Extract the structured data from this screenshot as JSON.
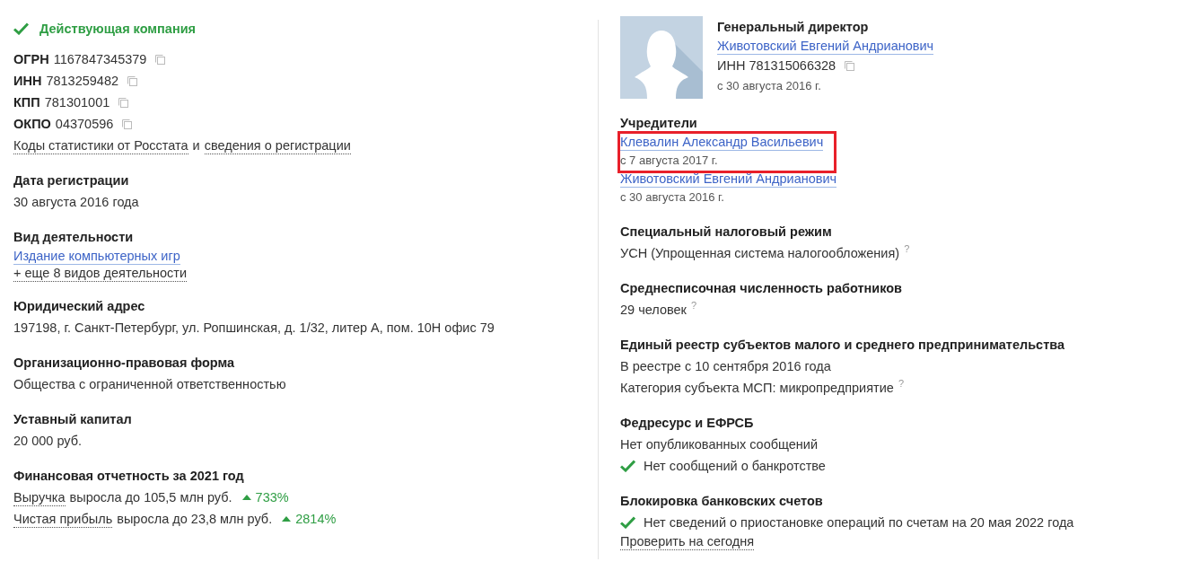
{
  "status": {
    "text": "Действующая компания",
    "active": true
  },
  "left_sections": [
    {
      "lines": [
        {
          "parts": [
            {
              "kind": "label",
              "text": "ОГРН"
            },
            {
              "kind": "text",
              "text": "1167847345379"
            },
            {
              "kind": "copy"
            }
          ]
        },
        {
          "parts": [
            {
              "kind": "label",
              "text": "ИНН"
            },
            {
              "kind": "text",
              "text": "7813259482"
            },
            {
              "kind": "copy"
            }
          ]
        },
        {
          "parts": [
            {
              "kind": "label",
              "text": "КПП"
            },
            {
              "kind": "text",
              "text": "781301001"
            },
            {
              "kind": "copy"
            }
          ]
        },
        {
          "parts": [
            {
              "kind": "label",
              "text": "ОКПО"
            },
            {
              "kind": "text",
              "text": "04370596"
            },
            {
              "kind": "copy"
            }
          ]
        },
        {
          "parts": [
            {
              "kind": "dotted",
              "text": "Коды статистики от Росстата"
            },
            {
              "kind": "text",
              "text": "и"
            },
            {
              "kind": "dotted",
              "text": "сведения о регистрации"
            }
          ]
        }
      ]
    },
    {
      "title": "Дата регистрации",
      "lines": [
        {
          "parts": [
            {
              "kind": "text",
              "text": "30 августа 2016 года"
            }
          ]
        }
      ]
    },
    {
      "title": "Вид деятельности",
      "lines": [
        {
          "parts": [
            {
              "kind": "link",
              "text": "Издание компьютерных игр"
            }
          ]
        },
        {
          "parts": [
            {
              "kind": "dotted",
              "text": "+ еще 8 видов деятельности"
            }
          ]
        }
      ]
    },
    {
      "title": "Юридический адрес",
      "lines": [
        {
          "parts": [
            {
              "kind": "text",
              "text": "197198, г. Санкт-Петербург, ул. Ропшинская, д. 1/32, литер А, пом. 10Н офис 79"
            }
          ]
        }
      ]
    },
    {
      "title": "Организационно-правовая форма",
      "lines": [
        {
          "parts": [
            {
              "kind": "text",
              "text": "Общества с ограниченной ответственностью"
            }
          ]
        }
      ]
    },
    {
      "title": "Уставный капитал",
      "lines": [
        {
          "parts": [
            {
              "kind": "text",
              "text": "20 000 руб."
            }
          ]
        }
      ]
    },
    {
      "title": "Финансовая отчетность за 2021 год",
      "lines": [
        {
          "parts": [
            {
              "kind": "dotted",
              "text": "Выручка"
            },
            {
              "kind": "text",
              "text": "выросла до 105,5 млн руб."
            },
            {
              "kind": "growth",
              "text": "733%"
            }
          ]
        },
        {
          "parts": [
            {
              "kind": "dotted",
              "text": "Чистая прибыль"
            },
            {
              "kind": "text",
              "text": "выросла до 23,8 млн руб."
            },
            {
              "kind": "growth",
              "text": "2814%"
            }
          ]
        }
      ]
    }
  ],
  "director": {
    "title": "Генеральный директор",
    "name": "Животовский Евгений Андрианович",
    "inn_label": "ИНН",
    "inn": "781315066328",
    "since": "с 30 августа 2016 г."
  },
  "founders": {
    "title": "Учредители",
    "items": [
      {
        "name": "Клевалин Александр Васильевич",
        "since": "с 7 августа 2017 г.",
        "highlighted": true
      },
      {
        "name": "Животовский Евгений Андрианович",
        "since": "с 30 августа 2016 г.",
        "highlighted": false
      }
    ]
  },
  "right_sections": [
    {
      "title": "Специальный налоговый режим",
      "lines": [
        {
          "parts": [
            {
              "kind": "text",
              "text": "УСН (Упрощенная система налогообложения)"
            },
            {
              "kind": "hint",
              "text": "?"
            }
          ]
        }
      ]
    },
    {
      "title": "Среднесписочная численность работников",
      "lines": [
        {
          "parts": [
            {
              "kind": "text",
              "text": "29 человек"
            },
            {
              "kind": "hint",
              "text": "?"
            }
          ]
        }
      ]
    },
    {
      "title": "Единый реестр субъектов малого и среднего предпринимательства",
      "lines": [
        {
          "parts": [
            {
              "kind": "text",
              "text": "В реестре с 10 сентября 2016 года"
            }
          ]
        },
        {
          "parts": [
            {
              "kind": "text",
              "text": "Категория субъекта МСП: микропредприятие"
            },
            {
              "kind": "hint",
              "text": "?"
            }
          ]
        }
      ]
    },
    {
      "title": "Федресурс и ЕФРСБ",
      "lines": [
        {
          "parts": [
            {
              "kind": "text",
              "text": "Нет опубликованных сообщений"
            }
          ]
        },
        {
          "parts": [
            {
              "kind": "check"
            },
            {
              "kind": "text",
              "text": "Нет сообщений о банкротстве"
            }
          ]
        }
      ]
    },
    {
      "title": "Блокировка банковских счетов",
      "lines": [
        {
          "parts": [
            {
              "kind": "check"
            },
            {
              "kind": "text",
              "text": "Нет сведений о приостановке операций по счетам на 20 мая 2022 года"
            }
          ]
        },
        {
          "parts": [
            {
              "kind": "dotted",
              "text": "Проверить на сегодня"
            }
          ]
        }
      ]
    }
  ]
}
